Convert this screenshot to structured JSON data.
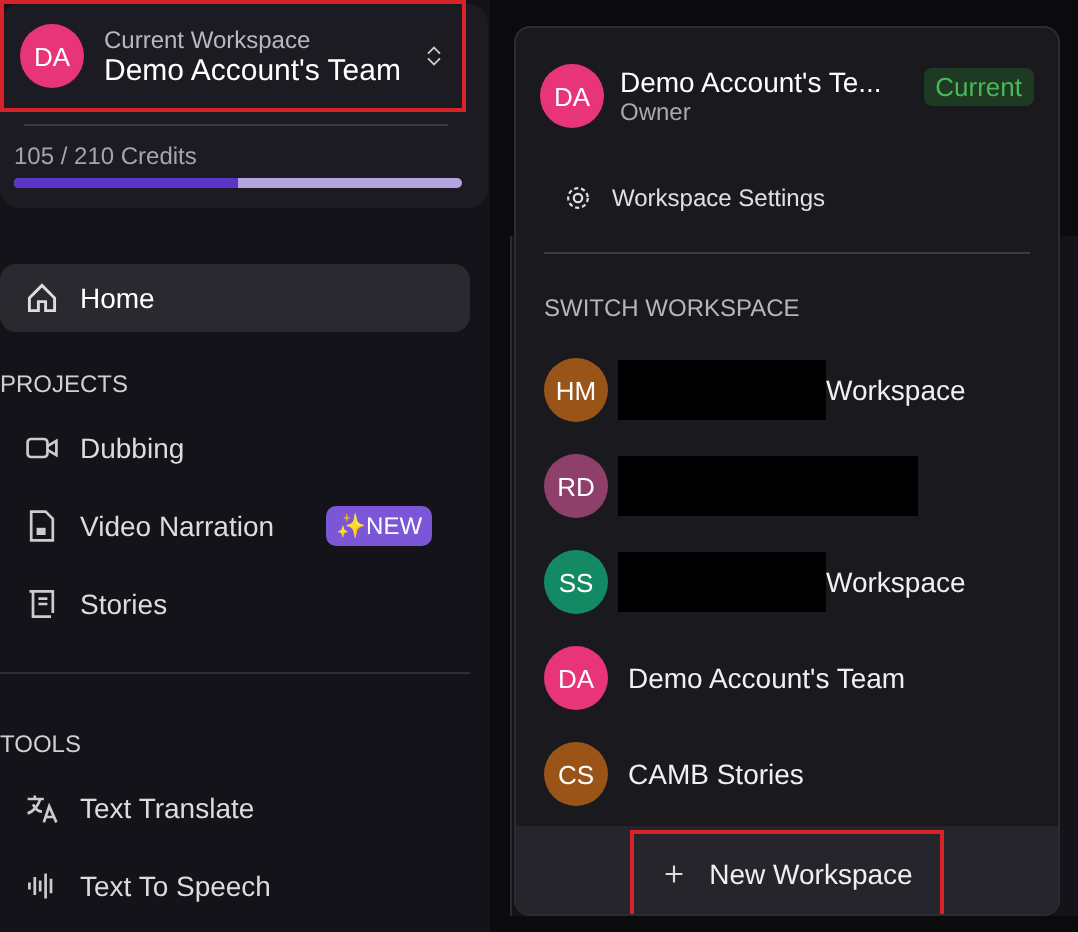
{
  "workspace_switcher": {
    "label": "Current Workspace",
    "name": "Demo Account's Team",
    "initials": "DA",
    "color": "#e8357a",
    "highlighted": true
  },
  "credits": {
    "text": "105 / 210 Credits",
    "level": 0.5
  },
  "sidebar": {
    "items": [
      {
        "kind": "item",
        "label": "Home",
        "selected": true
      },
      {
        "kind": "section",
        "label": "PROJECTS"
      },
      {
        "kind": "item",
        "label": "Dubbing",
        "selected": false
      },
      {
        "kind": "item",
        "label": "Video Narration",
        "selected": false,
        "badge": "✨NEW"
      },
      {
        "kind": "item",
        "label": "Stories",
        "selected": false
      },
      {
        "kind": "divider"
      },
      {
        "kind": "section",
        "label": "TOOLS"
      },
      {
        "kind": "item",
        "label": "Text Translate",
        "selected": false
      },
      {
        "kind": "item",
        "label": "Text To Speech",
        "selected": false
      }
    ]
  },
  "dropdown": {
    "current": {
      "initials": "DA",
      "name": "Demo Account's Te...",
      "role": "Owner",
      "badge": "Current",
      "color": "#e8357a"
    },
    "settings": "Workspace Settings",
    "section": "SWITCH WORKSPACE",
    "workspaces": [
      {
        "initials": "HM",
        "name": "Workspace",
        "redacted": true,
        "color": "#9a5418"
      },
      {
        "initials": "RD",
        "redacted": true,
        "color": "#8e3f6a"
      },
      {
        "initials": "SS",
        "name": "Workspace",
        "redacted": true,
        "color": "#138a63"
      },
      {
        "initials": "DA",
        "name": "Demo Account's Team",
        "redacted": false,
        "color": "#e8357a"
      },
      {
        "initials": "CS",
        "name": "CAMB Stories",
        "redacted": false,
        "color": "#9a5418"
      }
    ],
    "new_button": {
      "label": "New Workspace",
      "highlighted": true
    }
  }
}
